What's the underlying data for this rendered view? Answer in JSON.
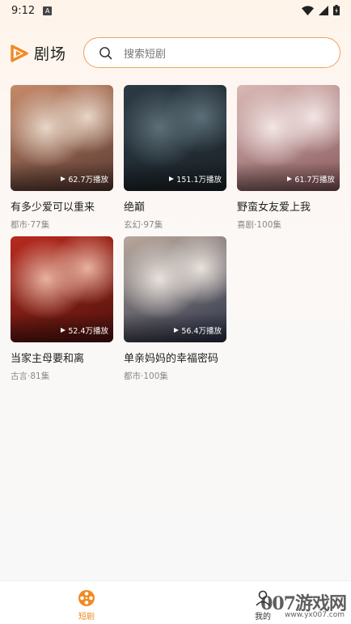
{
  "status_bar": {
    "time": "9:12",
    "notif_icon": "A"
  },
  "header": {
    "title": "剧场",
    "search_placeholder": "搜索短剧"
  },
  "dramas": [
    {
      "title": "有多少爱可以重来",
      "meta": "都市·77集",
      "plays": "62.7万播放",
      "colors": [
        "#c78a6a",
        "#e8d6c7",
        "#5a3a32"
      ]
    },
    {
      "title": "绝巅",
      "meta": "玄幻·97集",
      "plays": "151.1万播放",
      "colors": [
        "#2b3a44",
        "#5c6f78",
        "#1c2328"
      ]
    },
    {
      "title": "野蛮女友爱上我",
      "meta": "喜剧·100集",
      "plays": "61.7万播放",
      "colors": [
        "#d9b8b4",
        "#f3e6e5",
        "#8a5a5e"
      ]
    },
    {
      "title": "当家主母要和离",
      "meta": "古言·81集",
      "plays": "52.4万播放",
      "colors": [
        "#b82a1e",
        "#e8b2a0",
        "#4e120d"
      ]
    },
    {
      "title": "单亲妈妈的幸福密码",
      "meta": "都市·100集",
      "plays": "56.4万播放",
      "colors": [
        "#b9a89c",
        "#e9e2dc",
        "#2b3248"
      ]
    }
  ],
  "nav": {
    "tab1_label": "短剧",
    "tab2_label": "我的"
  },
  "watermark": {
    "text": "007游戏网",
    "url": "www.yx007.com"
  },
  "accent": "#f08a24"
}
